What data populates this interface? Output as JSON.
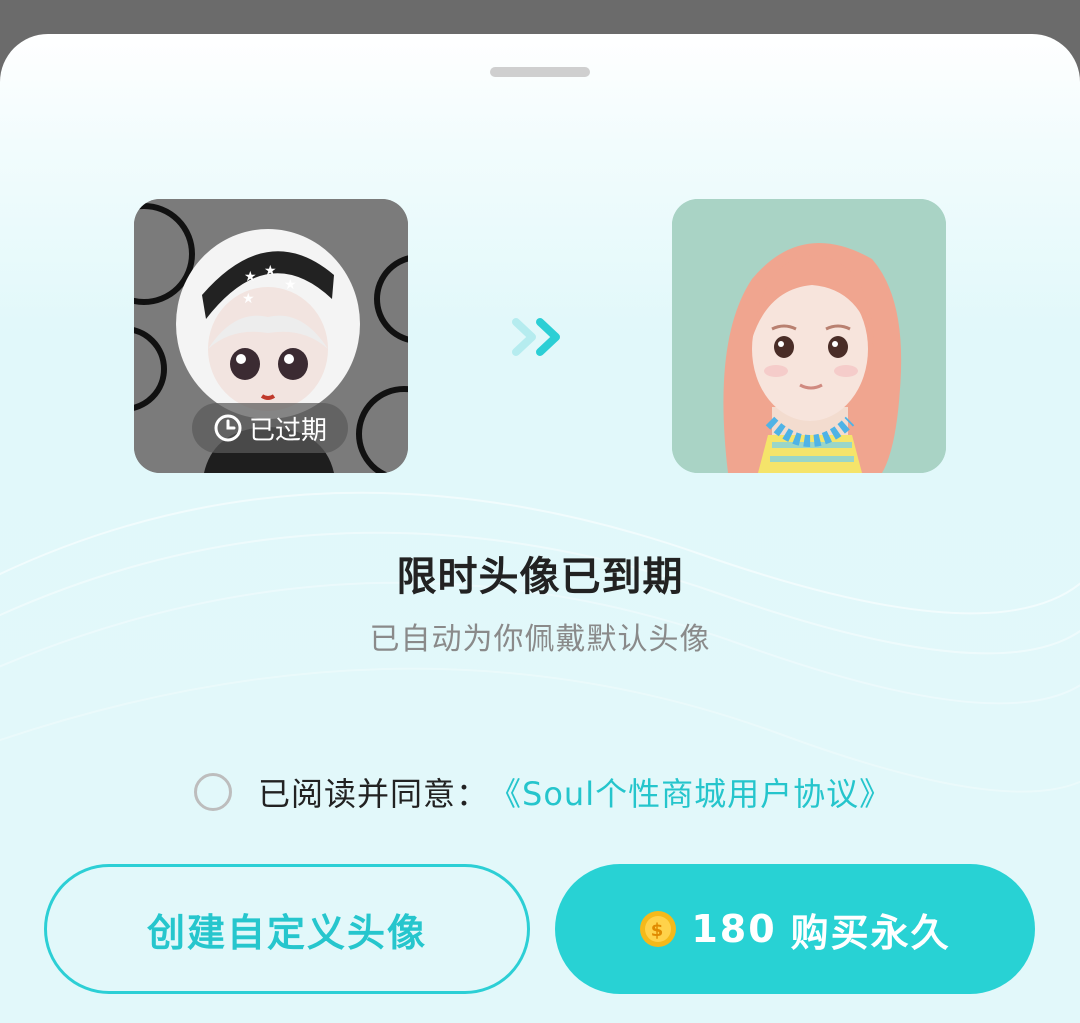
{
  "sheet": {
    "handle": "drag-handle"
  },
  "avatars": {
    "old": {
      "badge_icon": "clock-icon",
      "badge_label": "已过期"
    },
    "arrow_icon": "double-chevron-right-icon",
    "new": {}
  },
  "message": {
    "title": "限时头像已到期",
    "subtitle": "已自动为你佩戴默认头像"
  },
  "agreement": {
    "prefix": "已阅读并同意：",
    "link": "《Soul个性商城用户协议》",
    "checked": false
  },
  "buttons": {
    "custom_label": "创建自定义头像",
    "buy_amount": "180",
    "buy_label": "购买永久",
    "coin_icon": "coin-icon"
  },
  "colors": {
    "accent": "#28d2d4",
    "link": "#25c5cc"
  }
}
